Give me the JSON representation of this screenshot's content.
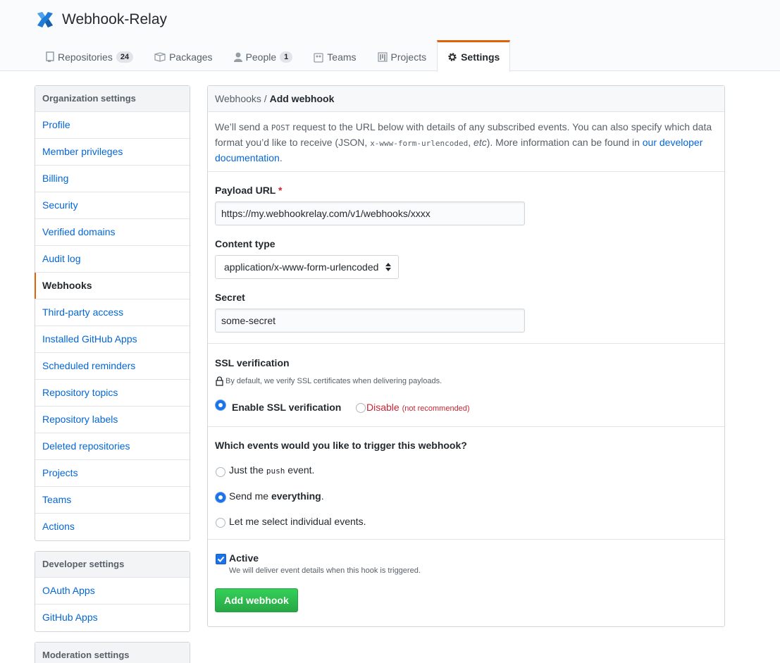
{
  "header": {
    "org_name": "Webhook-Relay",
    "logo_icon": "webhook-relay-logo",
    "accent_color": "#e36209",
    "tabs": [
      {
        "label": "Repositories",
        "count": "24",
        "icon": "repo-icon"
      },
      {
        "label": "Packages",
        "icon": "package-icon"
      },
      {
        "label": "People",
        "count": "1",
        "icon": "person-icon"
      },
      {
        "label": "Teams",
        "icon": "people-icon"
      },
      {
        "label": "Projects",
        "icon": "project-icon"
      },
      {
        "label": "Settings",
        "icon": "gear-icon",
        "selected": true
      }
    ]
  },
  "sidebar": {
    "org_heading": "Organization settings",
    "org_items": [
      "Profile",
      "Member privileges",
      "Billing",
      "Security",
      "Verified domains",
      "Audit log",
      "Webhooks",
      "Third-party access",
      "Installed GitHub Apps",
      "Scheduled reminders",
      "Repository topics",
      "Repository labels",
      "Deleted repositories",
      "Projects",
      "Teams",
      "Actions"
    ],
    "selected_item": "Webhooks",
    "dev_heading": "Developer settings",
    "dev_items": [
      "OAuth Apps",
      "GitHub Apps"
    ],
    "mod_heading": "Moderation settings"
  },
  "main": {
    "breadcrumb_parent": "Webhooks",
    "breadcrumb_sep": " / ",
    "breadcrumb_current": "Add webhook",
    "intro_1": "We’ll send a ",
    "intro_post": "POST",
    "intro_2": " request to the URL below with details of any subscribed events. You can also specify which data format you’d like to receive (JSON, ",
    "intro_format": "x-www-form-urlencoded",
    "intro_3": ", ",
    "intro_etc": "etc",
    "intro_4": "). More information can be found in ",
    "intro_link": "our developer documentation",
    "intro_5": ".",
    "payload_label": "Payload URL",
    "required_mark": "*",
    "payload_value": "https://my.webhookrelay.com/v1/webhooks/xxxx",
    "content_type_label": "Content type",
    "content_type_value": "application/x-www-form-urlencoded",
    "secret_label": "Secret",
    "secret_value": "some-secret",
    "ssl_heading": "SSL verification",
    "ssl_note": "By default, we verify SSL certificates when delivering payloads.",
    "ssl_enable_label": "Enable SSL verification",
    "ssl_disable_label": "Disable",
    "ssl_disable_note": "(not recommended)",
    "events_heading": "Which events would you like to trigger this webhook?",
    "event_push_1": "Just the ",
    "event_push_code": "push",
    "event_push_2": " event.",
    "event_all_1": "Send me ",
    "event_all_bold": "everything",
    "event_all_2": ".",
    "event_select": "Let me select individual events.",
    "active_label": "Active",
    "active_note": "We will deliver event details when this hook is triggered.",
    "submit_label": "Add webhook"
  }
}
